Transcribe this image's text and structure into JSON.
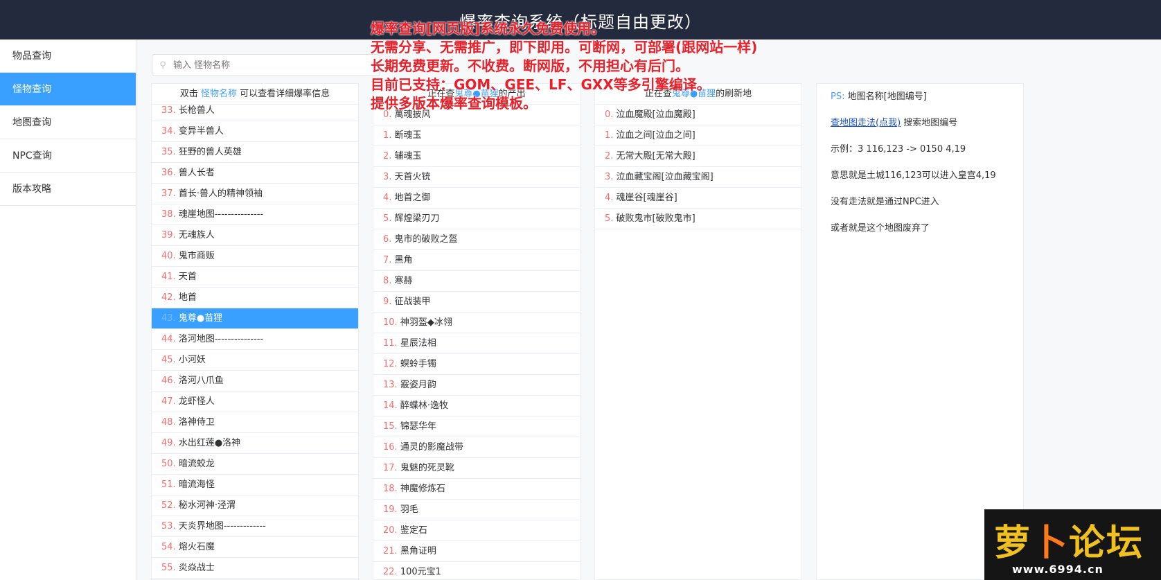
{
  "header": {
    "title": "爆率查询系统（标题自由更改）"
  },
  "sidebar": {
    "items": [
      {
        "label": "物品查询"
      },
      {
        "label": "怪物查询"
      },
      {
        "label": "地图查询"
      },
      {
        "label": "NPC查询"
      },
      {
        "label": "版本攻略"
      }
    ]
  },
  "search": {
    "placeholder": "输入 怪物名称"
  },
  "monster_list": {
    "head_prefix": "双击",
    "head_link": "怪物名称",
    "head_suffix": "可以查看详细爆率信息",
    "rows": [
      {
        "num": "33.",
        "name": "长枪兽人"
      },
      {
        "num": "34.",
        "name": "变异半兽人"
      },
      {
        "num": "35.",
        "name": "狂野的兽人英雄"
      },
      {
        "num": "36.",
        "name": "兽人长者"
      },
      {
        "num": "37.",
        "name": "酋长·兽人的精神领袖"
      },
      {
        "num": "38.",
        "name": "魂崖地图---------------"
      },
      {
        "num": "39.",
        "name": "无魂族人"
      },
      {
        "num": "40.",
        "name": "鬼市商贩"
      },
      {
        "num": "41.",
        "name": "天首"
      },
      {
        "num": "42.",
        "name": "地首"
      },
      {
        "num": "43.",
        "name": "鬼尊●苗狸"
      },
      {
        "num": "44.",
        "name": "洛河地图---------------"
      },
      {
        "num": "45.",
        "name": "小河妖"
      },
      {
        "num": "46.",
        "name": "洛河八爪鱼"
      },
      {
        "num": "47.",
        "name": "龙虾怪人"
      },
      {
        "num": "48.",
        "name": "洛神侍卫"
      },
      {
        "num": "49.",
        "name": "水出红莲●洛神"
      },
      {
        "num": "50.",
        "name": "暗流蛟龙"
      },
      {
        "num": "51.",
        "name": "暗流海怪"
      },
      {
        "num": "52.",
        "name": "秘水河神·泾渭"
      },
      {
        "num": "53.",
        "name": "天炎界地图-------------"
      },
      {
        "num": "54.",
        "name": "熔火石魔"
      },
      {
        "num": "55.",
        "name": "炎焱战士"
      }
    ]
  },
  "drops": {
    "head_prefix": "正在查",
    "head_link": "鬼尊●苗狸",
    "head_suffix": "的产出",
    "rows": [
      {
        "num": "0.",
        "name": "萬魂披风"
      },
      {
        "num": "1.",
        "name": "断魂玉"
      },
      {
        "num": "2.",
        "name": "辅魂玉"
      },
      {
        "num": "3.",
        "name": "天首火铳"
      },
      {
        "num": "4.",
        "name": "地首之御"
      },
      {
        "num": "5.",
        "name": "辉煌梁刃刀"
      },
      {
        "num": "6.",
        "name": "鬼市的破败之盔"
      },
      {
        "num": "7.",
        "name": "黑角"
      },
      {
        "num": "8.",
        "name": "寒赫"
      },
      {
        "num": "9.",
        "name": "征战装甲"
      },
      {
        "num": "10.",
        "name": "神羽盔◆冰翎"
      },
      {
        "num": "11.",
        "name": "星辰法相"
      },
      {
        "num": "12.",
        "name": "螟蛉手镯"
      },
      {
        "num": "13.",
        "name": "霰姿月韵"
      },
      {
        "num": "14.",
        "name": "醉蝶林·逸牧"
      },
      {
        "num": "15.",
        "name": "锦瑟华年"
      },
      {
        "num": "16.",
        "name": "通灵的影魔战带"
      },
      {
        "num": "17.",
        "name": "鬼魅的死灵靴"
      },
      {
        "num": "18.",
        "name": "神魔修炼石"
      },
      {
        "num": "19.",
        "name": "羽毛"
      },
      {
        "num": "20.",
        "name": "鉴定石"
      },
      {
        "num": "21.",
        "name": "黑角证明"
      },
      {
        "num": "22.",
        "name": "100元宝1"
      }
    ]
  },
  "maps": {
    "head_prefix": "正在查",
    "head_link": "鬼尊●苗狸",
    "head_suffix": "的刷新地",
    "rows": [
      {
        "num": "0.",
        "name": "泣血魔殿[泣血魔殿]"
      },
      {
        "num": "1.",
        "name": "泣血之间[泣血之间]"
      },
      {
        "num": "2.",
        "name": "无常大殿[无常大殿]"
      },
      {
        "num": "3.",
        "name": "泣血藏宝阁[泣血藏宝阁]"
      },
      {
        "num": "4.",
        "name": "魂崖谷[魂崖谷]"
      },
      {
        "num": "5.",
        "name": "破败鬼市[破败鬼市]"
      }
    ]
  },
  "info": {
    "ps_label": "PS:",
    "ps_text": "地图名称[地图编号]",
    "link": "查地图走法(点我)",
    "link_suffix": "搜索地图编号",
    "example": "示例：3 116,123 -> 0150 4,19",
    "meaning": "意思就是土城116,123可以进入皇宫4,19",
    "npc": "没有走法就是通过NPC进入",
    "abandoned": "或者就是这个地图废弃了"
  },
  "overlay": {
    "lines": [
      "爆率查询[网页版]系统永久免费使用。",
      "无需分享、无需推广，即下即用。可断网，可部署(跟网站一样)",
      "长期免费更新。不收费。断网版，不用担心有后门。",
      "目前已支持：GOM、GEE、LF、GXX等多引擎编译。",
      "提供多版本爆率查询模板。"
    ]
  },
  "watermark": {
    "logo_prefix": "萝",
    "logo_carrot": "卜",
    "logo_suffix": "论坛",
    "url": "www.6994.cn"
  },
  "colors": {
    "header_bg": "#242a3d",
    "accent": "#3aa0ff",
    "number": "#f56c6c",
    "overlay": "#e8202a"
  },
  "selected_monster_index": 10
}
